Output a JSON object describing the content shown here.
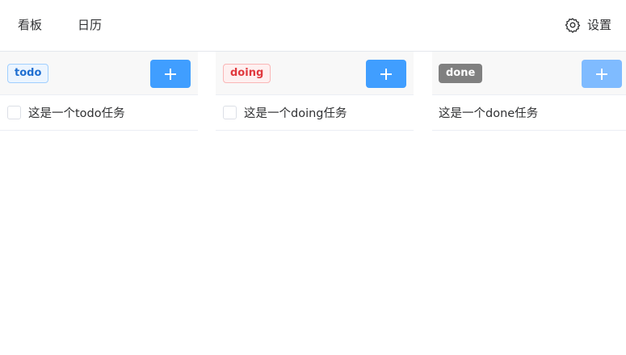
{
  "nav": {
    "kanban": "看板",
    "calendar": "日历",
    "settings": "设置",
    "settings_icon": "gear-icon"
  },
  "columns": [
    {
      "tag": "todo",
      "tag_color": "#1f6fd1",
      "add_icon": "plus-icon",
      "tasks": [
        {
          "text": "这是一个todo任务",
          "checked": false
        }
      ]
    },
    {
      "tag": "doing",
      "tag_color": "#e0393e",
      "add_icon": "plus-icon",
      "tasks": [
        {
          "text": "这是一个doing任务",
          "checked": false
        }
      ]
    },
    {
      "tag": "done",
      "tag_color": "#808080",
      "add_icon": "plus-icon",
      "add_disabled": true,
      "tasks": [
        {
          "text": "这是一个done任务"
        }
      ]
    }
  ],
  "colors": {
    "primary": "#409eff",
    "primary_disabled": "#7fbbff",
    "header_bg": "#f8f8f8"
  }
}
